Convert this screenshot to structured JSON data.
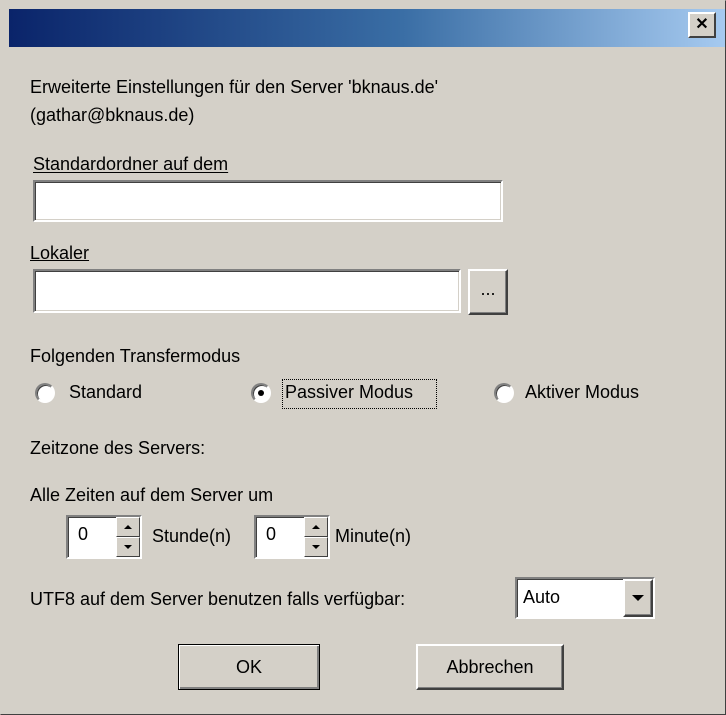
{
  "window": {
    "close_glyph": "✕",
    "heading_line1": "Erweiterte Einstellungen für den Server 'bknaus.de'",
    "heading_line2": "(gathar@bknaus.de)"
  },
  "default_folder": {
    "label": "Standardordner auf dem",
    "value": ""
  },
  "local": {
    "label": "Lokaler",
    "value": "",
    "browse_label": "..."
  },
  "transfer": {
    "label": "Folgenden Transfermodus",
    "options": [
      {
        "label": "Standard",
        "selected": false
      },
      {
        "label": "Passiver Modus",
        "selected": true
      },
      {
        "label": "Aktiver Modus",
        "selected": false
      }
    ]
  },
  "timezone": {
    "label": "Zeitzone des Servers:",
    "offset_label": "Alle Zeiten auf dem Server um",
    "hours_value": "0",
    "hours_unit": "Stunde(n)",
    "minutes_value": "0",
    "minutes_unit": "Minute(n)"
  },
  "utf8": {
    "label": "UTF8 auf dem Server benutzen falls verfügbar:",
    "selected": "Auto"
  },
  "buttons": {
    "ok": "OK",
    "cancel": "Abbrechen"
  },
  "colors": {
    "dialog_bg": "#d4d0c8",
    "titlebar_start": "#0a246a",
    "titlebar_end": "#a6caf0"
  }
}
